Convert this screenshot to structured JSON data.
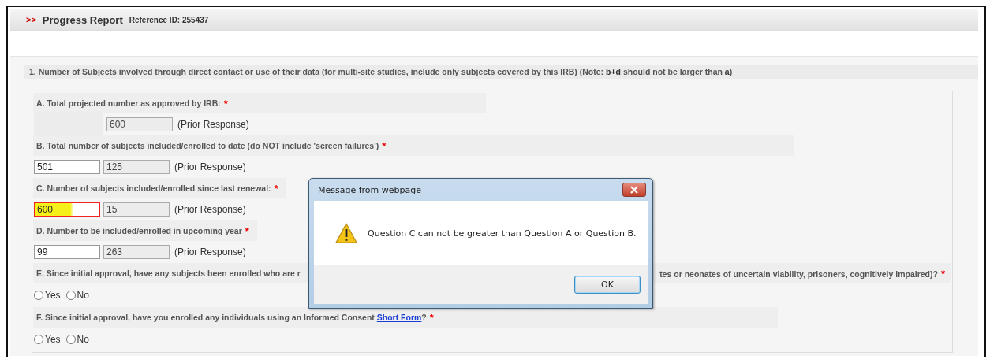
{
  "header": {
    "marker": ">>",
    "title": "Progress Report",
    "reference": "Reference ID: 255437"
  },
  "section": {
    "question": "1. Number of Subjects involved through direct contact or use of their data (for multi-site studies, include only subjects covered by this IRB) (Note: **b+d** should not be larger than **a**)",
    "items": [
      {
        "kind": "prior_only",
        "label": "A. Total projected number as approved by IRB:",
        "required_mark": "*",
        "prior_value": "600",
        "prior_label": "(Prior Response)"
      },
      {
        "kind": "numeric",
        "label": "B. Total number of subjects included/enrolled to date (do NOT include 'screen failures')",
        "required_mark": "*",
        "value": "501",
        "error": false,
        "highlighted": false,
        "prior_value": "125",
        "prior_label": "(Prior Response)"
      },
      {
        "kind": "numeric",
        "label": "C. Number of subjects included/enrolled since last renewal:",
        "required_mark": "*",
        "value": "600",
        "error": true,
        "highlighted": true,
        "prior_value": "15",
        "prior_label": "(Prior Response)"
      },
      {
        "kind": "numeric",
        "label": "D. Number to be included/enrolled in upcoming year",
        "required_mark": "*",
        "value": "99",
        "error": false,
        "highlighted": false,
        "prior_value": "263",
        "prior_label": "(Prior Response)"
      },
      {
        "kind": "yes_no",
        "label_start": "E. Since initial approval, have any subjects been enrolled who are r",
        "label_end": "tes or neonates of uncertain viability, prisoners, cognitively impaired)?",
        "required_mark": "*",
        "options": [
          {
            "label": "Yes",
            "selected": false
          },
          {
            "label": "No",
            "selected": false
          }
        ]
      },
      {
        "kind": "yes_no",
        "label_start": "F. Since initial approval, have you enrolled any individuals using an Informed Consent",
        "link": "Short Form",
        "label_end": "?",
        "required_mark": "*",
        "options": [
          {
            "label": "Yes",
            "selected": false
          },
          {
            "label": "No",
            "selected": false
          }
        ]
      }
    ]
  },
  "dialog": {
    "title": "Message from webpage",
    "message": "Question C can not be greater than Question A or Question B.",
    "ok": "OK"
  }
}
